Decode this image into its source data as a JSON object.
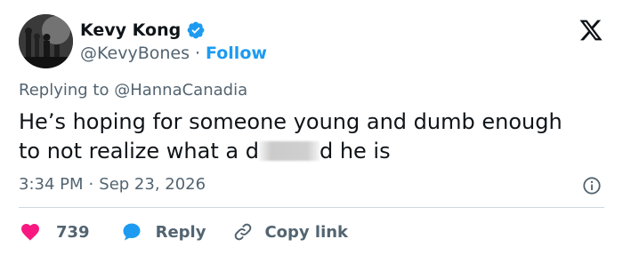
{
  "author": {
    "display_name": "Kevy Kong",
    "handle": "@KevyBones",
    "separator": "·",
    "follow_label": "Follow"
  },
  "reply_context": {
    "prefix": "Replying to ",
    "mention": "@HannaCanadia"
  },
  "tweet": {
    "text_line1": "He’s hoping for someone young and dumb enough",
    "text_line2_before": "to not realize what a d",
    "text_line2_after": "d he is",
    "time": "3:34 PM",
    "separator": "·",
    "date": "Sep 23, 2026"
  },
  "actions": {
    "like_count": "739",
    "reply_label": "Reply",
    "copy_label": "Copy link"
  },
  "icons": {
    "verified": "verified-badge-icon",
    "x_logo": "x-logo-icon",
    "info": "info-icon",
    "like": "heart-icon",
    "reply": "speech-bubble-icon",
    "copy": "link-icon"
  },
  "colors": {
    "accent_blue": "#1d9bf0",
    "like_pink": "#f91880",
    "muted_text": "#536471",
    "text": "#0f1419",
    "divider": "#cfd9de"
  }
}
